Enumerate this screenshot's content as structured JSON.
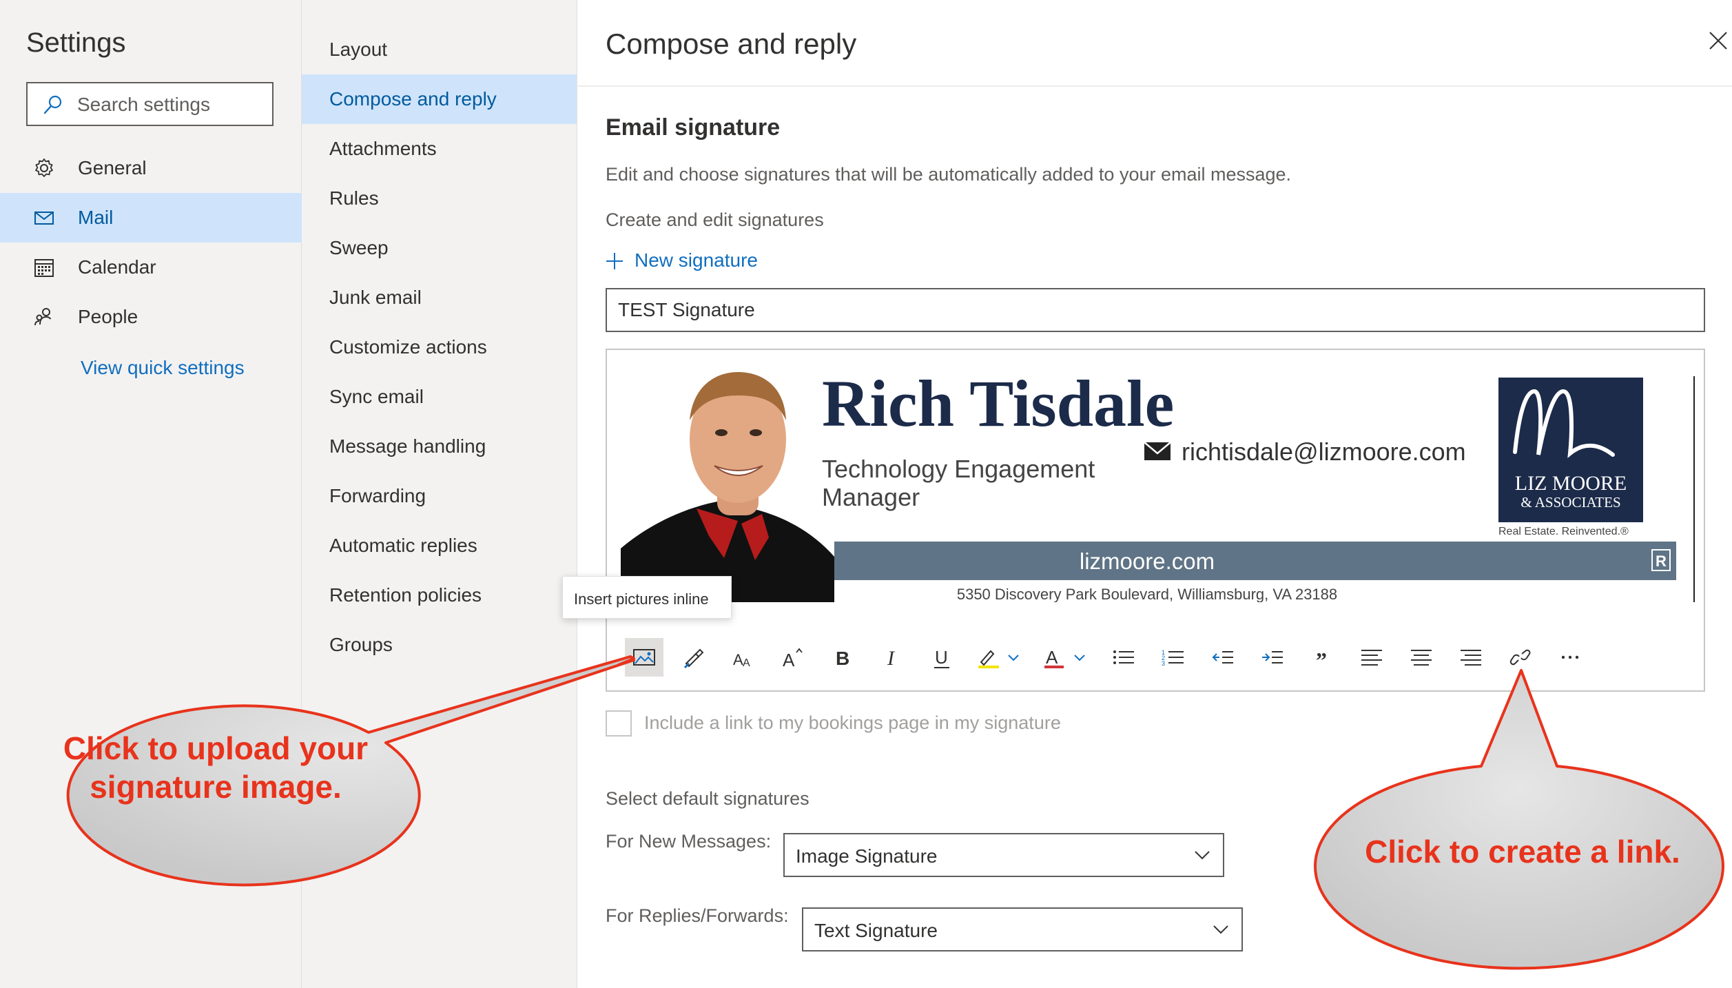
{
  "left_nav": {
    "title": "Settings",
    "search_placeholder": "Search settings",
    "items": [
      {
        "label": "General",
        "icon": "gear-icon"
      },
      {
        "label": "Mail",
        "icon": "mail-icon",
        "selected": true
      },
      {
        "label": "Calendar",
        "icon": "calendar-icon"
      },
      {
        "label": "People",
        "icon": "people-icon"
      }
    ],
    "view_quick_settings": "View quick settings"
  },
  "sub_nav": {
    "items": [
      {
        "label": "Layout"
      },
      {
        "label": "Compose and reply",
        "selected": true
      },
      {
        "label": "Attachments"
      },
      {
        "label": "Rules"
      },
      {
        "label": "Sweep"
      },
      {
        "label": "Junk email"
      },
      {
        "label": "Customize actions"
      },
      {
        "label": "Sync email"
      },
      {
        "label": "Message handling"
      },
      {
        "label": "Forwarding"
      },
      {
        "label": "Automatic replies"
      },
      {
        "label": "Retention policies"
      },
      {
        "label": "Groups"
      }
    ]
  },
  "main": {
    "title": "Compose and reply",
    "section_title": "Email signature",
    "description": "Edit and choose signatures that will be automatically added to your email message.",
    "create_edit_label": "Create and edit signatures",
    "new_signature": "New signature",
    "signature_name_value": "TEST Signature",
    "signature": {
      "name": "Rich Tisdale",
      "job_title_line1": "Technology Engagement",
      "job_title_line2": "Manager",
      "email": "richtisdale@lizmoore.com",
      "logo_line1": "LIZ MOORE",
      "logo_line2": "& ASSOCIATES",
      "logo_tagline": "Real Estate. Reinvented.®",
      "website": "lizmoore.com",
      "address": "5350 Discovery Park Boulevard, Williamsburg, VA 23188"
    },
    "toolbar_tooltip": "Insert pictures inline",
    "toolbar": [
      {
        "name": "insert-picture-icon"
      },
      {
        "name": "format-painter-icon"
      },
      {
        "name": "font-size-icon"
      },
      {
        "name": "grow-font-icon"
      },
      {
        "name": "bold-icon"
      },
      {
        "name": "italic-icon"
      },
      {
        "name": "underline-icon"
      },
      {
        "name": "highlight-icon"
      },
      {
        "name": "font-color-icon"
      },
      {
        "name": "bullets-icon"
      },
      {
        "name": "numbering-icon"
      },
      {
        "name": "decrease-indent-icon"
      },
      {
        "name": "increase-indent-icon"
      },
      {
        "name": "quote-icon"
      },
      {
        "name": "align-left-icon"
      },
      {
        "name": "align-center-icon"
      },
      {
        "name": "align-right-icon"
      },
      {
        "name": "link-icon"
      },
      {
        "name": "more-options-icon"
      }
    ],
    "bookings_checkbox": "Include a link to my bookings page in my signature",
    "select_default_label": "Select default signatures",
    "for_new_messages_label": "For New Messages:",
    "for_new_messages_value": "Image Signature",
    "for_replies_label": "For Replies/Forwards:",
    "for_replies_value": "Text Signature"
  },
  "annotations": {
    "left_callout_line1": "Click to upload your",
    "left_callout_line2": "signature image.",
    "right_callout": "Click to create a link.",
    "color": "#e8331c"
  },
  "colors": {
    "accent": "#106ebe",
    "selected_bg": "#cfe4fa",
    "nav_bg": "#f3f2f1",
    "logo_navy": "#1c2b4a",
    "banner_slate": "#5f7486"
  }
}
